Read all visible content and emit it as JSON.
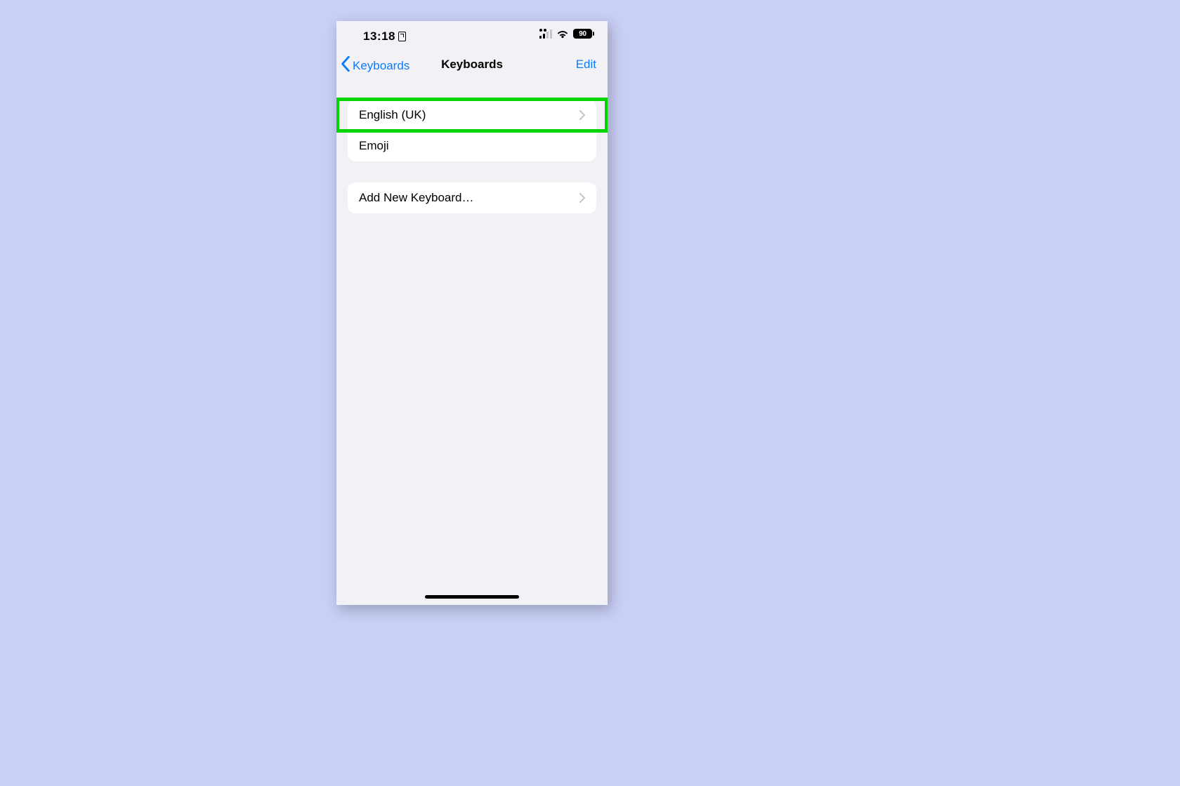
{
  "status": {
    "time": "13:18",
    "battery_percent": "90"
  },
  "nav": {
    "back_label": "Keyboards",
    "title": "Keyboards",
    "edit_label": "Edit"
  },
  "keyboards_list": {
    "items": [
      {
        "label": "English (UK)",
        "has_chevron": true,
        "highlighted": true
      },
      {
        "label": "Emoji",
        "has_chevron": false,
        "highlighted": false
      }
    ]
  },
  "actions": {
    "add_new_label": "Add New Keyboard…"
  },
  "colors": {
    "accent": "#0b7bff",
    "highlight": "#00d300",
    "bg": "#f2f2f6",
    "page_bg": "#c9cff5"
  }
}
